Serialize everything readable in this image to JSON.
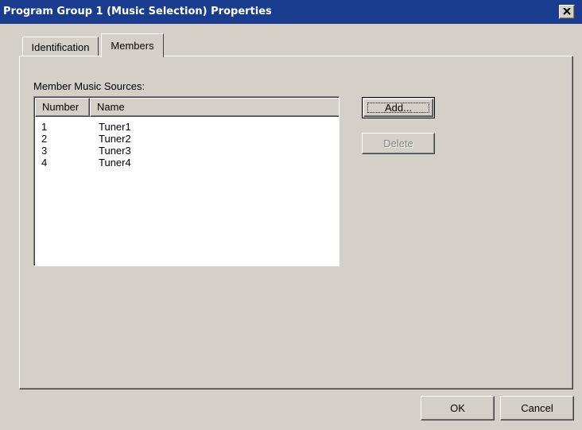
{
  "window": {
    "title": "Program Group 1 (Music Selection) Properties",
    "close_glyph": "✕"
  },
  "tabs": [
    {
      "label": "Identification",
      "selected": false
    },
    {
      "label": "Members",
      "selected": true
    }
  ],
  "members": {
    "group_label": "Member Music Sources:",
    "columns": [
      "Number",
      "Name"
    ],
    "rows": [
      {
        "number": "1",
        "name": "Tuner1"
      },
      {
        "number": "2",
        "name": "Tuner2"
      },
      {
        "number": "3",
        "name": "Tuner3"
      },
      {
        "number": "4",
        "name": "Tuner4"
      }
    ],
    "add_label": "Add...",
    "delete_label": "Delete"
  },
  "footer": {
    "ok_label": "OK",
    "cancel_label": "Cancel"
  },
  "colors": {
    "titlebar": "#1a3c8f",
    "face": "#d4d0c8",
    "disabled_text": "#808080"
  }
}
